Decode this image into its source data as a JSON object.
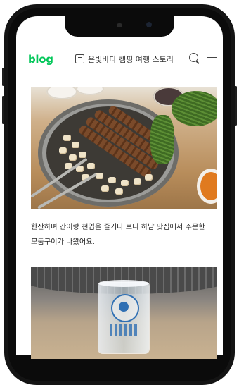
{
  "header": {
    "logo_text": "blog",
    "blog_name": "은빛바다 캠핑 여행 스토리",
    "accent_color": "#03c75a",
    "icons": [
      "post-list-icon",
      "search-icon",
      "hamburger-menu-icon"
    ]
  },
  "post": {
    "caption": "한잔하며 간이랑 천엽을 즐기다 보니 하남 맛집에서 주문한 모둠구이가 나왔어요."
  }
}
